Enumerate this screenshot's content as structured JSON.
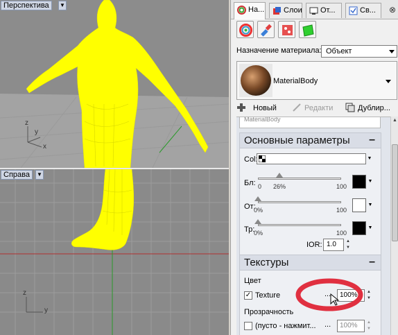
{
  "viewports": {
    "top": {
      "label": "Перспектива",
      "axes": {
        "z": "z",
        "y": "y",
        "x": "x"
      }
    },
    "bottom": {
      "label": "Справа",
      "axes": {
        "z": "z",
        "y": "y"
      }
    },
    "colors": {
      "model": "#ffff00",
      "grid": "#a3a3a3",
      "background": "#8a8a8a"
    }
  },
  "tabs": [
    {
      "label": "На...",
      "icon": "material-tab-icon"
    },
    {
      "label": "Слои",
      "icon": "layers-tab-icon"
    },
    {
      "label": "От...",
      "icon": "display-tab-icon"
    },
    {
      "label": "Св...",
      "icon": "properties-tab-icon"
    }
  ],
  "material": {
    "assign_label": "Назначение материала:",
    "assign_value": "Объект",
    "name": "MaterialBody",
    "actions": {
      "new": "Новый",
      "edit": "Редакти",
      "duplicate": "Дублир..."
    },
    "prev_name": "MaterialBody"
  },
  "basic": {
    "title": "Основные параметры",
    "collapse": "–",
    "col_label": "Col:",
    "bl": {
      "label": "Бл:",
      "min": "0",
      "value": "26%",
      "max": "100",
      "fraction": 0.26,
      "swatch": "#000000"
    },
    "ot": {
      "label": "От:",
      "value": "0%",
      "max": "100",
      "fraction": 0.0,
      "swatch": "#ffffff"
    },
    "tr": {
      "label": "Тр:",
      "value": "0%",
      "max": "100",
      "fraction": 0.0,
      "swatch": "#000000"
    },
    "ior": {
      "label": "IOR:",
      "value": "1.0"
    }
  },
  "textures": {
    "title": "Текстуры",
    "collapse": "–",
    "color_label": "Цвет",
    "texture": {
      "checked": true,
      "label": "Texture",
      "more": "...",
      "amount": "100%"
    },
    "transparency_label": "Прозрачность",
    "transparency": {
      "checked": false,
      "label": "(пусто - нажмит...",
      "more": "...",
      "amount": "100%"
    }
  },
  "annotation_color": "#e03040"
}
